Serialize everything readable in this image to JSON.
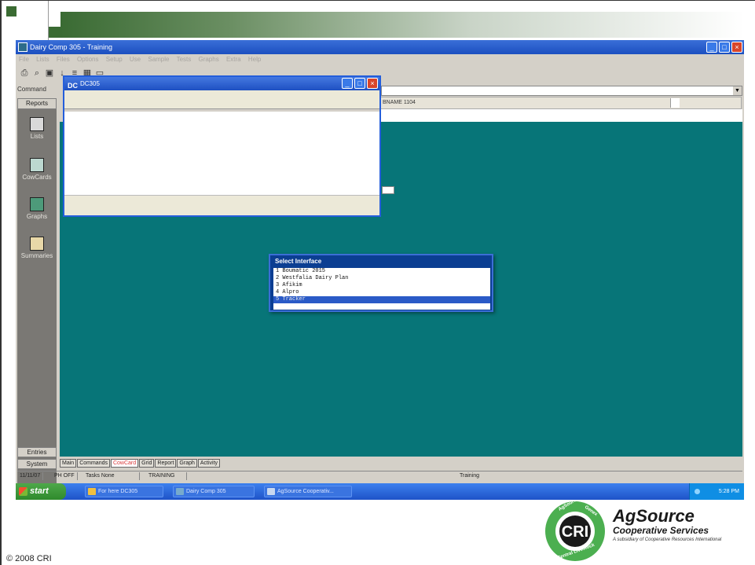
{
  "app": {
    "title": "Dairy Comp 305 - Training",
    "menu": [
      "File",
      "Lists",
      "Files",
      "Options",
      "Setup",
      "Use",
      "Sample",
      "Tests",
      "Graphs",
      "Extra",
      "Help"
    ],
    "command_label": "Command",
    "record_text": "BNAME 1104"
  },
  "sidebar": {
    "header": "Reports",
    "items": [
      {
        "label": "Lists",
        "icon": "list-icon"
      },
      {
        "label": "CowCards",
        "icon": "cowcard-icon"
      },
      {
        "label": "Graphs",
        "icon": "graph-icon"
      },
      {
        "label": "Summaries",
        "icon": "summary-icon"
      }
    ],
    "entries": "Entries",
    "system": "System"
  },
  "dialog": {
    "title": "DC305"
  },
  "select_interface": {
    "title": "Select Interface",
    "options": [
      "1  Boumatic 2015",
      "2  Westfalia Dairy Plan",
      "3  Afikim",
      "4  Alpro",
      "5  Tracker"
    ],
    "selected_index": 4
  },
  "tabs": {
    "items": [
      "Main",
      "Commands",
      "CowCard",
      "Grid",
      "Report",
      "Graph",
      "Activity"
    ],
    "active_index": 2
  },
  "statusbar": {
    "date": "11/11/07",
    "mode": "PH OFF",
    "task": "Tasks None",
    "training": "TRAINING",
    "right": "Training"
  },
  "taskbar": {
    "start": "start",
    "tasks": [
      "For here DC305",
      "Dairy Comp 305",
      "AgSource Cooperativ..."
    ],
    "clock": "5:28 PM"
  },
  "branding": {
    "name": "AgSource",
    "subtitle": "Cooperative Services",
    "tagline": "A subsidiary of Cooperative Resources International",
    "logo_text": "CRI",
    "logo_ring": [
      "AgSource",
      "Genex",
      "Central Livestock"
    ],
    "copyright": "© 2008 CRI"
  },
  "colors": {
    "teal": "#077578",
    "green": "#3a6b33",
    "xp_blue": "#1c4fc0"
  }
}
